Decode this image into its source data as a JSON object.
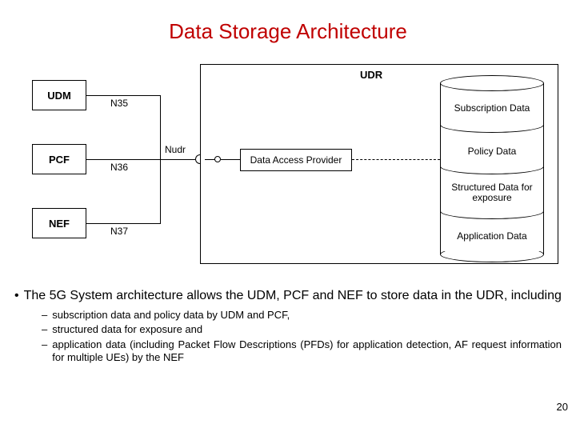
{
  "title": "Data Storage Architecture",
  "diagram": {
    "left_boxes": [
      "UDM",
      "PCF",
      "NEF"
    ],
    "interface_labels": [
      "N35",
      "N36",
      "N37"
    ],
    "nudr_label": "Nudr",
    "udr_title": "UDR",
    "dap_label": "Data Access Provider",
    "cylinder_sections": [
      "Subscription Data",
      "Policy Data",
      "Structured Data for exposure",
      "Application Data"
    ]
  },
  "bullet_main": "The 5G System architecture allows the UDM, PCF and NEF to store data in the UDR, including",
  "sub_bullets": [
    "subscription data and policy data by UDM and PCF,",
    "structured data for exposure and",
    "application data (including Packet Flow Descriptions (PFDs) for application detection, AF request information for multiple UEs) by the NEF"
  ],
  "page_number": "20"
}
